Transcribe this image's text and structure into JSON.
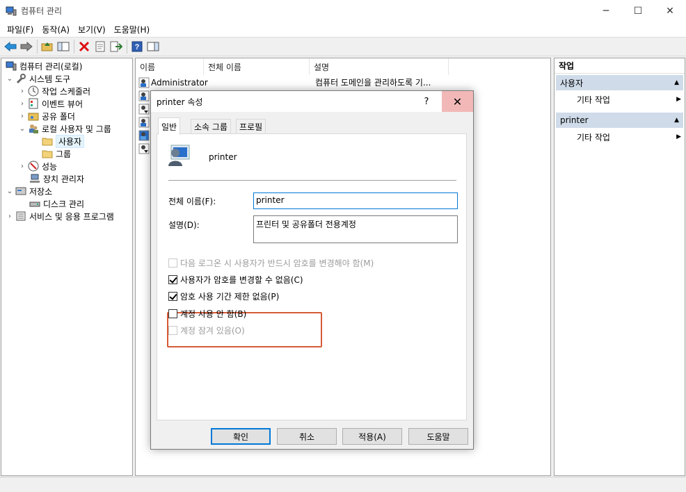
{
  "window": {
    "title": "컴퓨터 관리",
    "minimize": "─",
    "maximize": "☐",
    "close": "✕"
  },
  "menu": [
    "파일(F)",
    "동작(A)",
    "보기(V)",
    "도움말(H)"
  ],
  "tree": {
    "root": "컴퓨터 관리(로컬)",
    "system_tools": "시스템 도구",
    "task_scheduler": "작업 스케줄러",
    "event_viewer": "이벤트 뷰어",
    "shared_folders": "공유 폴더",
    "local_users_groups": "로컬 사용자 및 그룹",
    "users": "사용자",
    "groups": "그룹",
    "performance": "성능",
    "device_manager": "장치 관리자",
    "storage": "저장소",
    "disk_management": "디스크 관리",
    "services_apps": "서비스 및 응용 프로그램"
  },
  "list": {
    "columns": [
      "이름",
      "전체 이름",
      "설명"
    ],
    "rows": [
      {
        "name": "Administrator",
        "full_name": "",
        "description": "컴퓨터 도메인을 관리하도록 기..."
      }
    ]
  },
  "actions": {
    "title": "작업",
    "section1": "사용자",
    "section1_item": "기타 작업",
    "section2": "printer",
    "section2_item": "기타 작업"
  },
  "dialog": {
    "title": "printer 속성",
    "help": "?",
    "close": "✕",
    "tabs": [
      "일반",
      "소속 그룹",
      "프로필"
    ],
    "username": "printer",
    "full_name_label": "전체 이름(F):",
    "full_name_value": "printer",
    "description_label": "설명(D):",
    "description_value": "프린터 및 공유폴더 전용계정",
    "checkboxes": {
      "must_change": {
        "label": "다음 로그온 시 사용자가 반드시 암호를 변경해야 함(M)",
        "checked": false,
        "disabled": true
      },
      "cannot_change": {
        "label": "사용자가 암호를 변경할 수 없음(C)",
        "checked": true,
        "disabled": false
      },
      "never_expires": {
        "label": "암호 사용 기간 제한 없음(P)",
        "checked": true,
        "disabled": false
      },
      "disabled_acct": {
        "label": "계정 사용 안 함(B)",
        "checked": false,
        "disabled": false
      },
      "locked_out": {
        "label": "계정 잠겨 있음(O)",
        "checked": false,
        "disabled": true
      }
    },
    "buttons": {
      "ok": "확인",
      "cancel": "취소",
      "apply": "적용(A)",
      "help": "도움말"
    }
  },
  "colors": {
    "highlight_box": "#d65a35",
    "action_section": "#cfdbe9",
    "accent": "#0078d7",
    "close_hover": "#f2b8b8"
  }
}
